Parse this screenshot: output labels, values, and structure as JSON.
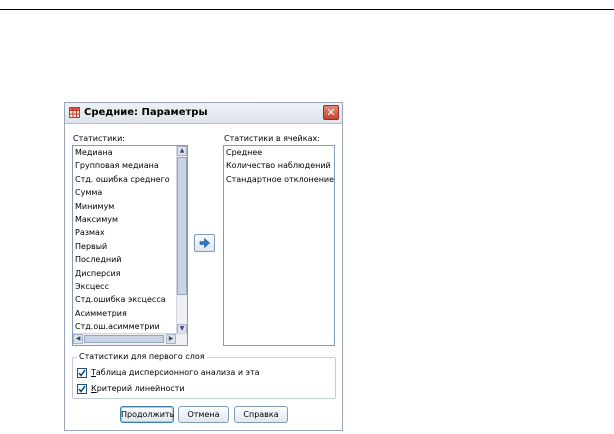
{
  "dialog": {
    "title": "Средние: Параметры"
  },
  "statistics_list": {
    "label": "Статистики:",
    "items": [
      "Медиана",
      "Групповая медиана",
      "Стд. ошибка среднего",
      "Сумма",
      "Минимум",
      "Максимум",
      "Размах",
      "Первый",
      "Последний",
      "Дисперсия",
      "Эксцесс",
      "Стд.ошибка эксцесса",
      "Асимметрия",
      "Стд.ош.асимметрии"
    ]
  },
  "cell_statistics_list": {
    "label": "Статистики в ячейках:",
    "items": [
      "Среднее",
      "Количество наблюдений",
      "Стандартное отклонение"
    ]
  },
  "first_layer_group": {
    "title": "Статистики для первого слоя",
    "anova": {
      "hotkey": "Т",
      "rest": "аблица дисперсионного анализа и эта",
      "checked": true
    },
    "linearity": {
      "hotkey": "К",
      "rest": "ритерий линейности",
      "checked": true
    }
  },
  "buttons": {
    "continue": "Продолжить",
    "cancel": "Отмена",
    "help": "Справка"
  },
  "icons": {
    "app": "table-icon",
    "close": "close-icon",
    "move": "arrow-right-icon"
  },
  "colors": {
    "accent": "#1c5180",
    "close": "#c2452f",
    "move_arrow": "#2f78c4"
  }
}
